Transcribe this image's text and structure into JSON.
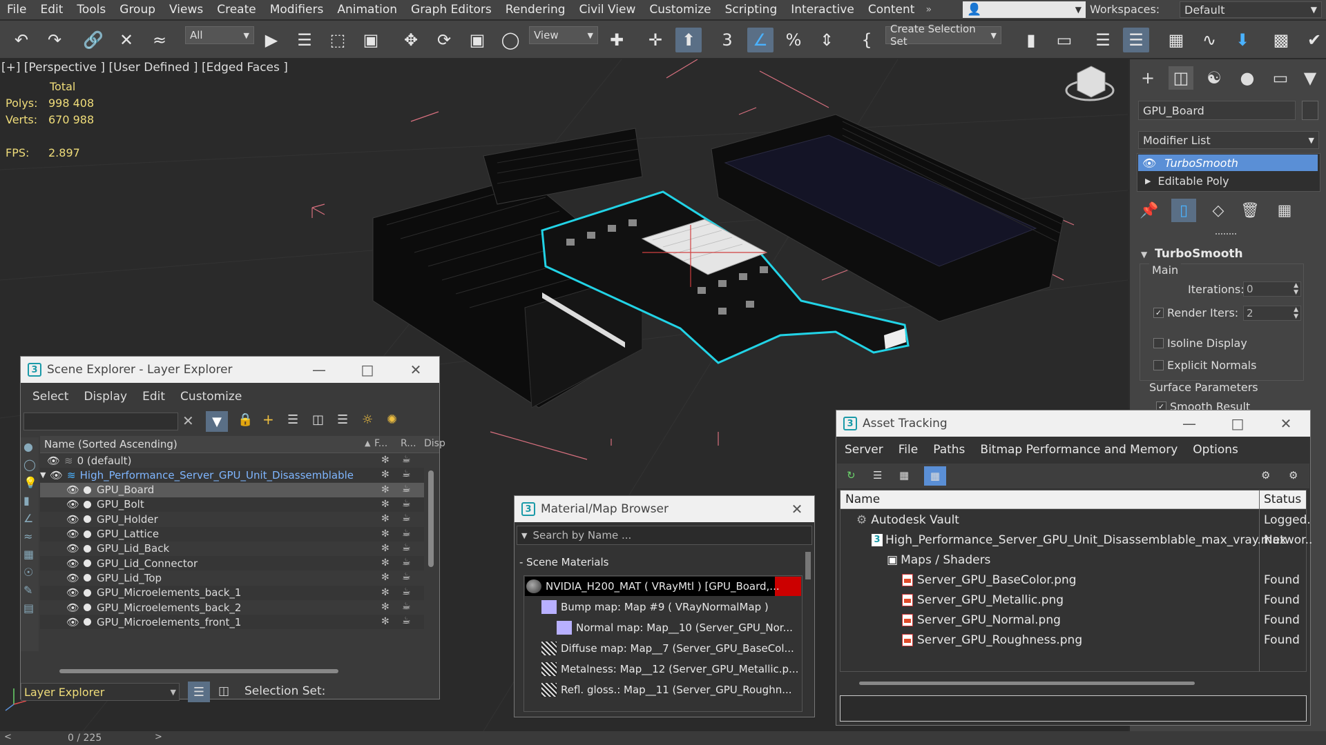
{
  "menu": [
    "File",
    "Edit",
    "Tools",
    "Group",
    "Views",
    "Create",
    "Modifiers",
    "Animation",
    "Graph Editors",
    "Rendering",
    "Civil View",
    "Customize",
    "Scripting",
    "Interactive",
    "Content"
  ],
  "menu_more": "»",
  "workspaces_label": "Workspaces:",
  "workspace_value": "Default",
  "toolbar": {
    "filter_value": "All",
    "refcoord_value": "View",
    "selection_set_value": "Create Selection Set",
    "snap_angle_label": "3",
    "percent_label": "%"
  },
  "viewport": {
    "label": "[+] [Perspective ] [User Defined ] [Edged Faces ]",
    "total_label": "Total",
    "polys_label": "Polys:",
    "polys_value": "998 408",
    "verts_label": "Verts:",
    "verts_value": "670 988",
    "fps_label": "FPS:",
    "fps_value": "2.897"
  },
  "command_panel": {
    "object_name": "GPU_Board",
    "modifier_list": "Modifier List",
    "stack": [
      "TurboSmooth",
      "Editable Poly"
    ],
    "rollout_title": "TurboSmooth",
    "group_main": "Main",
    "iterations_label": "Iterations:",
    "iterations_value": "0",
    "render_iters_label": "Render Iters:",
    "render_iters_value": "2",
    "render_iters_checked": true,
    "isoline_label": "Isoline Display",
    "explicit_normals_label": "Explicit Normals",
    "surface_params_label": "Surface Parameters",
    "smooth_result_label": "Smooth Result"
  },
  "scene_explorer": {
    "title": "Scene Explorer - Layer Explorer",
    "menu": [
      "Select",
      "Display",
      "Edit",
      "Customize"
    ],
    "col_name": "Name (Sorted Ascending)",
    "col_f": "F...",
    "col_r": "R...",
    "col_disp": "Disp",
    "rows": [
      {
        "label": "0 (default)",
        "indent": 0,
        "kind": "layer"
      },
      {
        "label": "High_Performance_Server_GPU_Unit_Disassemblable",
        "indent": 0,
        "kind": "layer-active"
      },
      {
        "label": "GPU_Board",
        "indent": 1,
        "kind": "object-selected"
      },
      {
        "label": "GPU_Bolt",
        "indent": 1,
        "kind": "object"
      },
      {
        "label": "GPU_Holder",
        "indent": 1,
        "kind": "object"
      },
      {
        "label": "GPU_Lattice",
        "indent": 1,
        "kind": "object"
      },
      {
        "label": "GPU_Lid_Back",
        "indent": 1,
        "kind": "object"
      },
      {
        "label": "GPU_Lid_Connector",
        "indent": 1,
        "kind": "object"
      },
      {
        "label": "GPU_Lid_Top",
        "indent": 1,
        "kind": "object"
      },
      {
        "label": "GPU_Microelements_back_1",
        "indent": 1,
        "kind": "object"
      },
      {
        "label": "GPU_Microelements_back_2",
        "indent": 1,
        "kind": "object"
      },
      {
        "label": "GPU_Microelements_front_1",
        "indent": 1,
        "kind": "object"
      }
    ],
    "footer_dropdown": "Layer Explorer",
    "selection_set_label": "Selection Set:"
  },
  "material_browser": {
    "title": "Material/Map Browser",
    "search_placeholder": "Search by Name ...",
    "section": "- Scene Materials",
    "rows": [
      {
        "label": "NVIDIA_H200_MAT  ( VRayMtl )  [GPU_Board,...",
        "indent": 0,
        "thumb": "sphere"
      },
      {
        "label": "Bump map: Map #9  ( VRayNormalMap )",
        "indent": 1,
        "thumb": "lilac"
      },
      {
        "label": "Normal map: Map__10 (Server_GPU_Nor...",
        "indent": 2,
        "thumb": "lilac"
      },
      {
        "label": "Diffuse  map: Map__7 (Server_GPU_BaseCol...",
        "indent": 1,
        "thumb": "dark"
      },
      {
        "label": "Metalness:  Map__12  (Server_GPU_Metallic.p...",
        "indent": 1,
        "thumb": "dark"
      },
      {
        "label": "Refl. gloss.: Map__11 (Server_GPU_Roughn...",
        "indent": 1,
        "thumb": "dark"
      }
    ]
  },
  "asset_tracking": {
    "title": "Asset Tracking",
    "menu": [
      "Server",
      "File",
      "Paths",
      "Bitmap Performance and Memory",
      "Options"
    ],
    "col_name": "Name",
    "col_status": "Status",
    "rows": [
      {
        "label": "Autodesk Vault",
        "status": "Logged.",
        "indent": 0,
        "icon": "vault"
      },
      {
        "label": "High_Performance_Server_GPU_Unit_Disassemblable_max_vray.max",
        "status": "Networ..",
        "indent": 1,
        "icon": "max"
      },
      {
        "label": "Maps / Shaders",
        "status": "",
        "indent": 2,
        "icon": "maps"
      },
      {
        "label": "Server_GPU_BaseColor.png",
        "status": "Found",
        "indent": 3,
        "icon": "png"
      },
      {
        "label": "Server_GPU_Metallic.png",
        "status": "Found",
        "indent": 3,
        "icon": "png"
      },
      {
        "label": "Server_GPU_Normal.png",
        "status": "Found",
        "indent": 3,
        "icon": "png"
      },
      {
        "label": "Server_GPU_Roughness.png",
        "status": "Found",
        "indent": 3,
        "icon": "png"
      }
    ]
  },
  "timeline": {
    "frame": "0 / 225"
  },
  "colors": {
    "accent": "#4ab2ff",
    "selection": "#5a8fd6",
    "wire_select": "#22d3e6",
    "stats": "#f0dd7a"
  }
}
